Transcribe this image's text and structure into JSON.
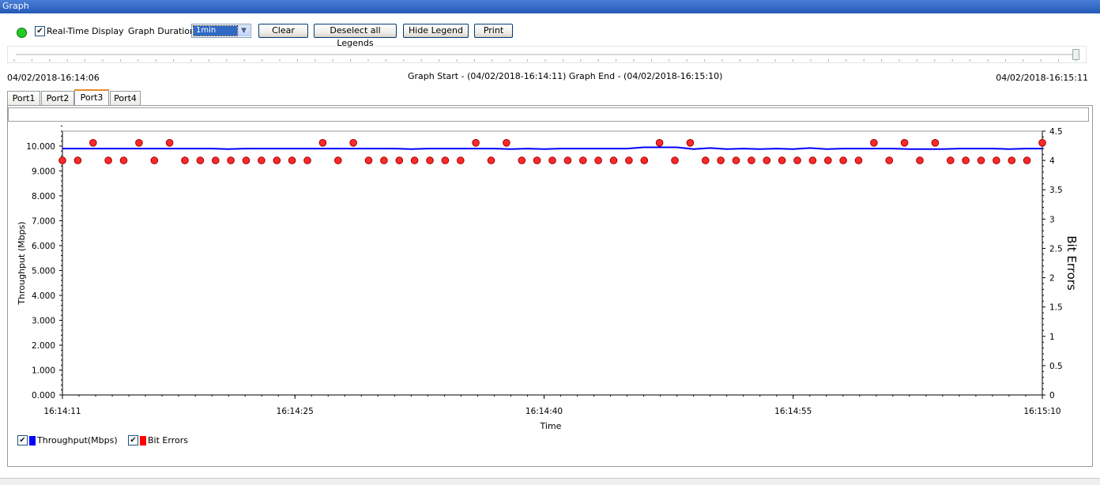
{
  "window": {
    "title": "Graph"
  },
  "toolbar": {
    "realtime_label": "Real-Time Display",
    "realtime_checked": true,
    "duration_label": "Graph Duration",
    "duration_value": "1min",
    "clear_label": "Clear",
    "deselect_label": "Deselect all Legends",
    "hide_legend_label": "Hide Legend",
    "print_label": "Print",
    "status_color": "#22cc22"
  },
  "timeline": {
    "left_time": "04/02/2018-16:14:06",
    "center_text": "Graph Start - (04/02/2018-16:14:11) Graph End - (04/02/2018-16:15:10)",
    "right_time": "04/02/2018-16:15:11"
  },
  "tabs": [
    {
      "label": "Port1",
      "active": false
    },
    {
      "label": "Port2",
      "active": false
    },
    {
      "label": "Port3",
      "active": true
    },
    {
      "label": "Port4",
      "active": false
    }
  ],
  "legend": [
    {
      "label": "Throughput(Mbps)",
      "checked": true,
      "color": "#0000ff"
    },
    {
      "label": "Bit Errors",
      "checked": true,
      "color": "#ff0000"
    }
  ],
  "chart_data": {
    "type": "line",
    "xlabel": "Time",
    "ylabel": "Throughput (Mbps)",
    "y2label": "Bit Errors",
    "x_ticks": [
      "16:14:11",
      "16:14:25",
      "16:14:40",
      "16:14:55",
      "16:15:10"
    ],
    "x_range_seconds": [
      0,
      59
    ],
    "y_ticks": [
      "0.000",
      "1.000",
      "2.000",
      "3.000",
      "4.000",
      "5.000",
      "6.000",
      "7.000",
      "8.000",
      "9.000",
      "10.000"
    ],
    "ylim": [
      0,
      10.6
    ],
    "y2_ticks": [
      "0",
      "0.5",
      "1",
      "1.5",
      "2",
      "2.5",
      "3",
      "3.5",
      "4",
      "4.5"
    ],
    "y2lim": [
      0,
      4.5
    ],
    "grid": false,
    "series": [
      {
        "name": "Throughput(Mbps)",
        "color": "#0000ff",
        "axis": "left",
        "values": [
          9.9,
          9.9,
          9.9,
          9.9,
          9.9,
          9.9,
          9.9,
          9.9,
          9.9,
          9.9,
          9.88,
          9.9,
          9.9,
          9.9,
          9.9,
          9.9,
          9.9,
          9.9,
          9.9,
          9.9,
          9.9,
          9.88,
          9.9,
          9.9,
          9.9,
          9.9,
          9.9,
          9.88,
          9.9,
          9.88,
          9.9,
          9.9,
          9.9,
          9.9,
          9.9,
          9.95,
          9.95,
          9.95,
          9.88,
          9.92,
          9.88,
          9.9,
          9.88,
          9.9,
          9.88,
          9.92,
          9.88,
          9.9,
          9.9,
          9.9,
          9.9,
          9.88,
          9.88,
          9.88,
          9.9,
          9.9,
          9.9,
          9.88,
          9.9,
          9.9
        ]
      },
      {
        "name": "Bit Errors",
        "color": "#ff0000",
        "axis": "right",
        "marker": "circle",
        "values": [
          4,
          4,
          4.3,
          4,
          4,
          4.3,
          4,
          4.3,
          4,
          4,
          4,
          4,
          4,
          4,
          4,
          4,
          4,
          4.3,
          4,
          4.3,
          4,
          4,
          4,
          4,
          4,
          4,
          4,
          4.3,
          4,
          4.3,
          4,
          4,
          4,
          4,
          4,
          4,
          4,
          4,
          4,
          4.3,
          4,
          4.3,
          4,
          4,
          4,
          4,
          4,
          4,
          4,
          4,
          4,
          4,
          4,
          4.3,
          4,
          4.3,
          4,
          4.3,
          4,
          4,
          4,
          4,
          4,
          4,
          4.3
        ]
      }
    ]
  }
}
